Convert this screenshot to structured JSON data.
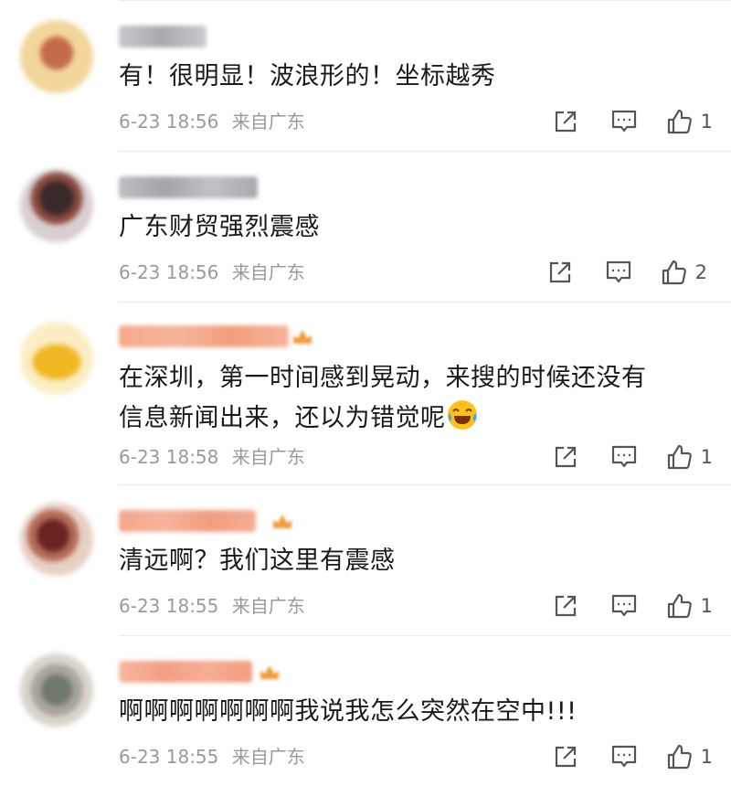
{
  "comments": [
    {
      "text": "有！很明显！波浪形的！坐标越秀",
      "time": "6-23 18:56",
      "source": "来自广东",
      "likes": "1",
      "avatar_colors": [
        "#f4d79a",
        "#c06a4a"
      ],
      "name_color": "#b9b9bf",
      "has_badge": false
    },
    {
      "text": "广东财贸强烈震感",
      "time": "6-23 18:56",
      "source": "来自广东",
      "likes": "2",
      "avatar_colors": [
        "#d9cfd0",
        "#3b2a2a"
      ],
      "name_color": "#b4b4bb",
      "has_badge": false
    },
    {
      "text": "在深圳，第一时间感到晃动，来搜的时候还没有信息新闻出来，还以为错觉呢",
      "text_line1": "在深圳，第一时间感到晃动，来搜的时候还没有",
      "text_line2": "信息新闻出来，还以为错觉呢",
      "time": "6-23 18:58",
      "source": "来自广东",
      "likes": "1",
      "avatar_colors": [
        "#fbeec4",
        "#f0b823"
      ],
      "name_color": "#f3a183",
      "has_badge": true
    },
    {
      "text": "清远啊？我们这里有震感",
      "time": "6-23 18:55",
      "source": "来自广东",
      "likes": "1",
      "avatar_colors": [
        "#e9d0c4",
        "#6b2220"
      ],
      "name_color": "#f2a587",
      "has_badge": true
    },
    {
      "text": "啊啊啊啊啊啊啊我说我怎么突然在空中!!!",
      "time": "6-23 18:55",
      "source": "来自广东",
      "likes": "1",
      "avatar_colors": [
        "#d9d4cc",
        "#6f7a6c"
      ],
      "name_color": "#f3a58a",
      "has_badge": true
    }
  ],
  "icons": {
    "share": "share-icon",
    "comment": "comment-icon",
    "like": "thumbs-up-icon",
    "emoji": "tears-of-joy-emoji"
  },
  "colors": {
    "meta": "#9a9a9a",
    "badge": "#f39a3b"
  }
}
